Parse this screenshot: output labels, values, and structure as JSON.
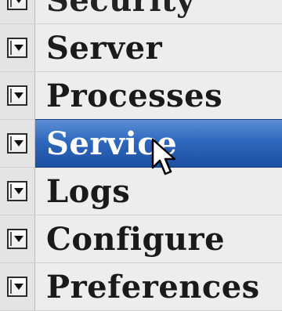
{
  "menu": {
    "items": [
      {
        "label": "Security",
        "selected": false
      },
      {
        "label": "Server",
        "selected": false
      },
      {
        "label": "Processes",
        "selected": false
      },
      {
        "label": "Service",
        "selected": true
      },
      {
        "label": "Logs",
        "selected": false
      },
      {
        "label": "Configure",
        "selected": false
      },
      {
        "label": "Preferences",
        "selected": false
      }
    ]
  },
  "colors": {
    "selection_top": "#5d8fd6",
    "selection_bottom": "#1d4f9f",
    "row_background": "#ededed",
    "text": "#1a1a1a"
  },
  "icons": {
    "toggle": "dropdown-toggle-icon",
    "cursor": "mouse-pointer-icon"
  }
}
